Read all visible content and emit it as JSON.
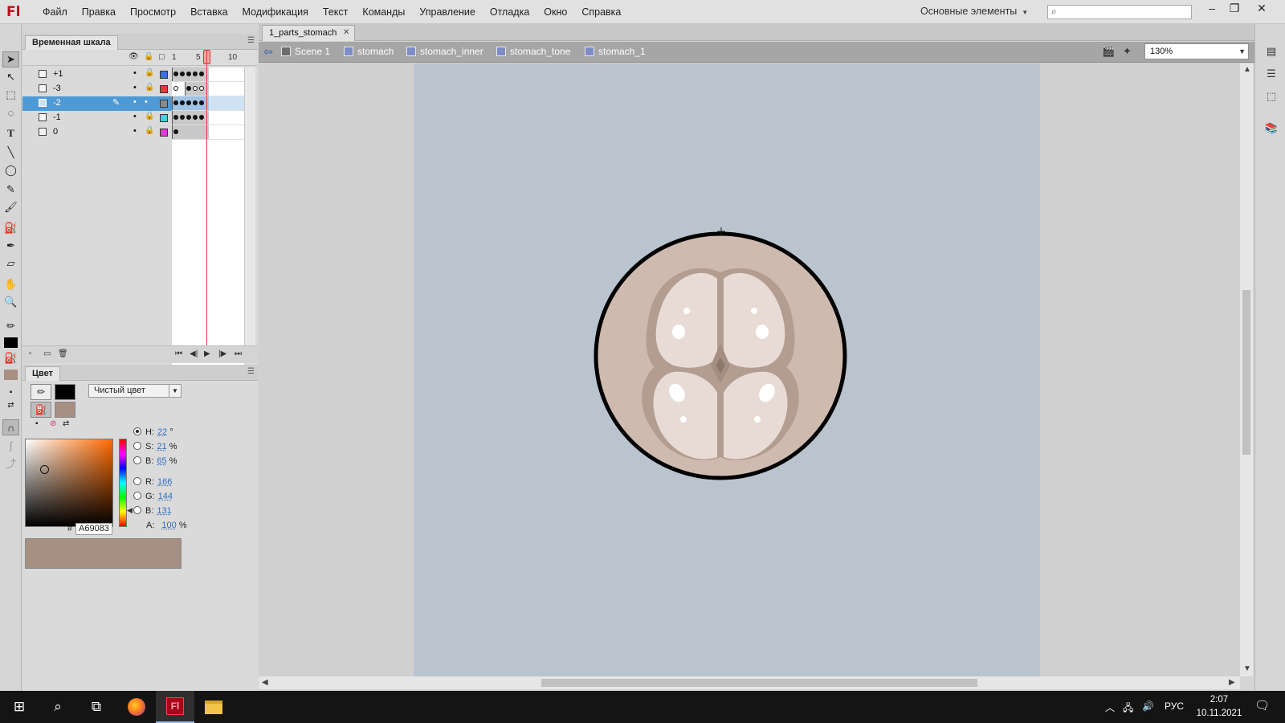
{
  "app": {
    "logo": "Fl",
    "menu": [
      "Файл",
      "Правка",
      "Просмотр",
      "Вставка",
      "Модификация",
      "Текст",
      "Команды",
      "Управление",
      "Отладка",
      "Окно",
      "Справка"
    ],
    "workspace": "Основные элементы",
    "search_placeholder": "",
    "window_controls": [
      "minimize",
      "restore",
      "close"
    ]
  },
  "timeline": {
    "tab": "Временная шкала",
    "frame_numbers": [
      "1",
      "5",
      "10"
    ],
    "current_frame": 5,
    "layers": [
      {
        "name": "+1",
        "color": "#3c6fd8",
        "selected": false
      },
      {
        "name": "-3",
        "color": "#e23a3a",
        "selected": false
      },
      {
        "name": "-2",
        "color": "#8a8a8a",
        "selected": true
      },
      {
        "name": "-1",
        "color": "#36d6e0",
        "selected": false
      },
      {
        "name": "0",
        "color": "#e03ad8",
        "selected": false
      }
    ]
  },
  "color_panel": {
    "tab": "Цвет",
    "stroke_color": "#000000",
    "fill_color": "#A69083",
    "fill_type": "Чистый цвет",
    "hsb": {
      "h": "22",
      "s": "21",
      "b": "65"
    },
    "rgb": {
      "r": "166",
      "g": "144",
      "b": "131"
    },
    "alpha": "100",
    "hex": "A69083",
    "labels": {
      "h": "H:",
      "s": "S:",
      "b": "B:",
      "r": "R:",
      "g": "G:",
      "bb": "B:",
      "a": "A:",
      "deg": "°",
      "pct": "%",
      "hash": "#"
    }
  },
  "document": {
    "tab": "1_parts_stomach",
    "breadcrumbs": [
      "Scene 1",
      "stomach",
      "stomach_inner",
      "stomach_tone",
      "stomach_1"
    ],
    "zoom": "130%",
    "stage_color": "#BAC4CF"
  },
  "taskbar": {
    "language": "РУС",
    "time": "2:07",
    "date": "10.11.2021"
  }
}
